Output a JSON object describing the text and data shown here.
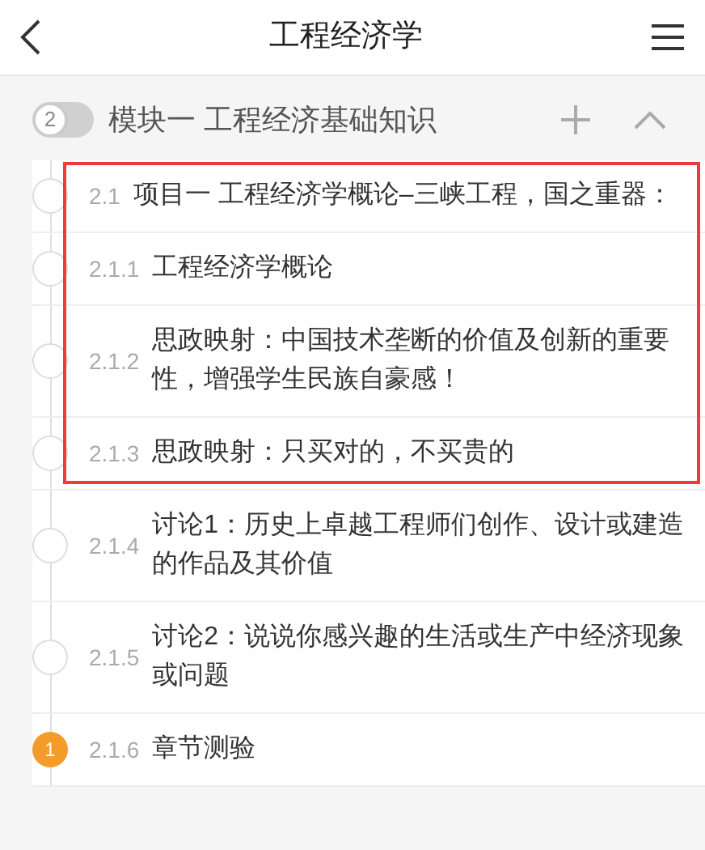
{
  "header": {
    "title": "工程经济学"
  },
  "module": {
    "badge": "2",
    "title": "模块一 工程经济基础知识",
    "expanded": true
  },
  "items": [
    {
      "number": "2.1",
      "title": "项目一  工程经济学概论–三峡工程，国之重器：",
      "highlighted": true
    },
    {
      "number": "2.1.1",
      "title": "工程经济学概论",
      "highlighted": true
    },
    {
      "number": "2.1.2",
      "title": "思政映射：中国技术垄断的价值及创新的重要性，增强学生民族自豪感！",
      "highlighted": true
    },
    {
      "number": "2.1.3",
      "title": "思政映射：只买对的，不买贵的",
      "highlighted": true
    },
    {
      "number": "2.1.4",
      "title": "讨论1：历史上卓越工程师们创作、设计或建造的作品及其价值",
      "highlighted": false
    },
    {
      "number": "2.1.5",
      "title": "讨论2：说说你感兴趣的生活或生产中经济现象或问题",
      "highlighted": false
    },
    {
      "number": "2.1.6",
      "title": "章节测验",
      "highlighted": false,
      "badge": "1"
    }
  ]
}
